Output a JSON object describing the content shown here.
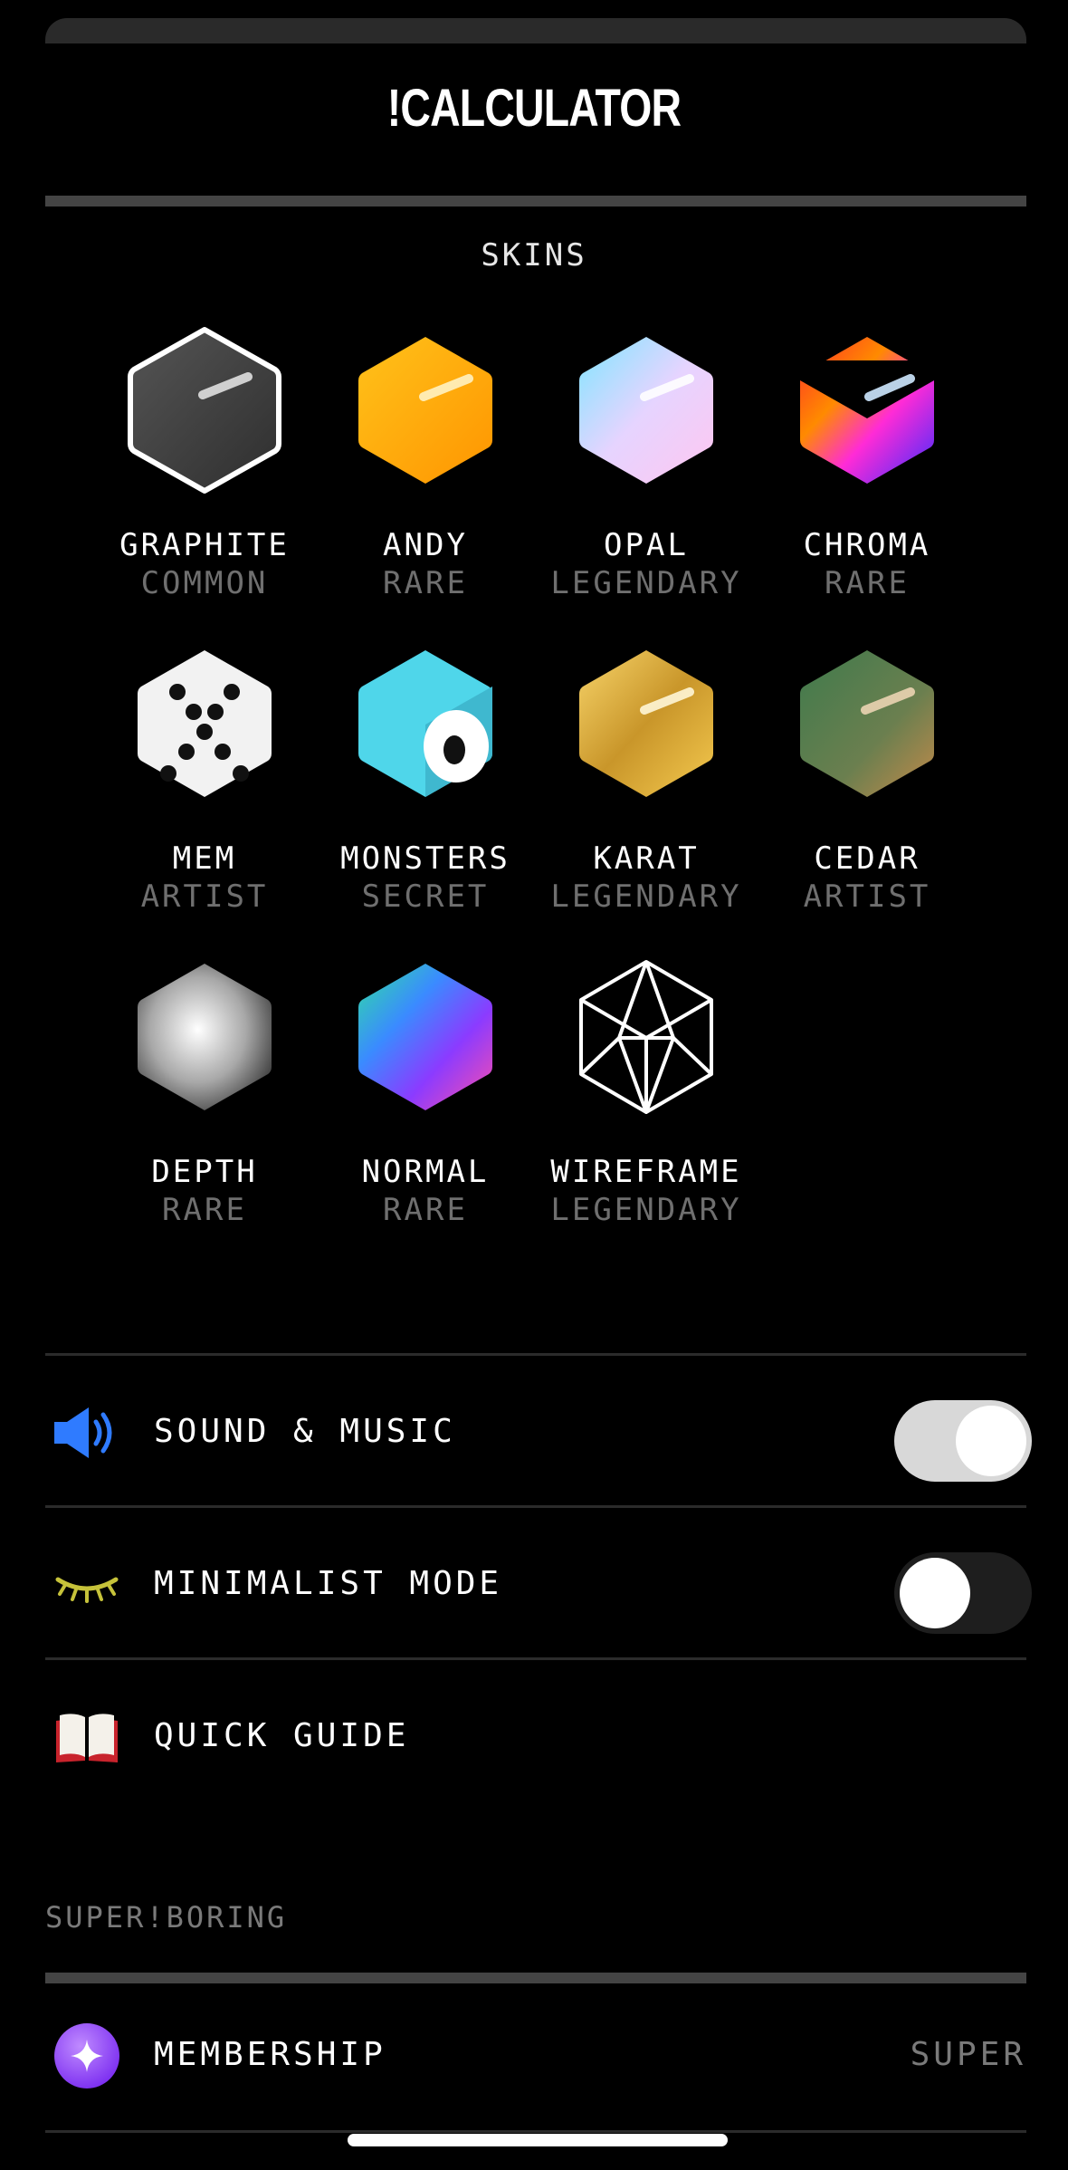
{
  "app": {
    "title": "!CALCULATOR"
  },
  "skins": {
    "section_title": "SKINS",
    "items": [
      {
        "name": "GRAPHITE",
        "rarity": "COMMON",
        "selected": true
      },
      {
        "name": "ANDY",
        "rarity": "RARE"
      },
      {
        "name": "OPAL",
        "rarity": "LEGENDARY"
      },
      {
        "name": "CHROMA",
        "rarity": "RARE"
      },
      {
        "name": "MEM",
        "rarity": "ARTIST"
      },
      {
        "name": "MONSTERS",
        "rarity": "SECRET"
      },
      {
        "name": "KARAT",
        "rarity": "LEGENDARY"
      },
      {
        "name": "CEDAR",
        "rarity": "ARTIST"
      },
      {
        "name": "DEPTH",
        "rarity": "RARE"
      },
      {
        "name": "NORMAL",
        "rarity": "RARE"
      },
      {
        "name": "WIREFRAME",
        "rarity": "LEGENDARY"
      }
    ]
  },
  "settings": {
    "sound": {
      "label": "SOUND & MUSIC",
      "enabled": true,
      "icon": "speaker-icon"
    },
    "minimalist": {
      "label": "MINIMALIST MODE",
      "enabled": false,
      "icon": "closed-eye-icon"
    },
    "guide": {
      "label": "QUICK GUIDE",
      "icon": "book-icon"
    }
  },
  "superboring": {
    "group_label": "SUPER!BORING",
    "membership": {
      "label": "MEMBERSHIP",
      "value": "SUPER",
      "icon": "sparkle-icon"
    }
  },
  "colors": {
    "background": "#000000",
    "rarity_text": "#6f6f6f",
    "andy": "#ffae00",
    "monsters": "#4fd6ea",
    "membership_purple": "#9b4dff"
  }
}
